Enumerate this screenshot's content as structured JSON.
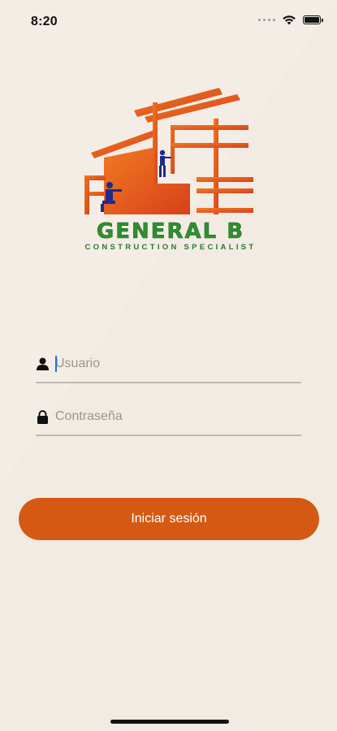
{
  "status_bar": {
    "time": "8:20",
    "icons": [
      "signal-dots-icon",
      "wifi-icon",
      "battery-icon"
    ]
  },
  "logo": {
    "title": "GENERAL B",
    "subtitle": "CONSTRUCTION SPECIALIST",
    "colors": {
      "orange": "#e8561c",
      "green": "#2f8f2f",
      "navy": "#1f2a8a"
    }
  },
  "form": {
    "username": {
      "placeholder": "Usuario",
      "value": "",
      "icon": "user-icon"
    },
    "password": {
      "placeholder": "Contraseña",
      "value": "",
      "icon": "lock-icon"
    },
    "login_label": "Iniciar sesión"
  },
  "colors": {
    "accent": "#d45a14",
    "background": "#efe7df"
  }
}
